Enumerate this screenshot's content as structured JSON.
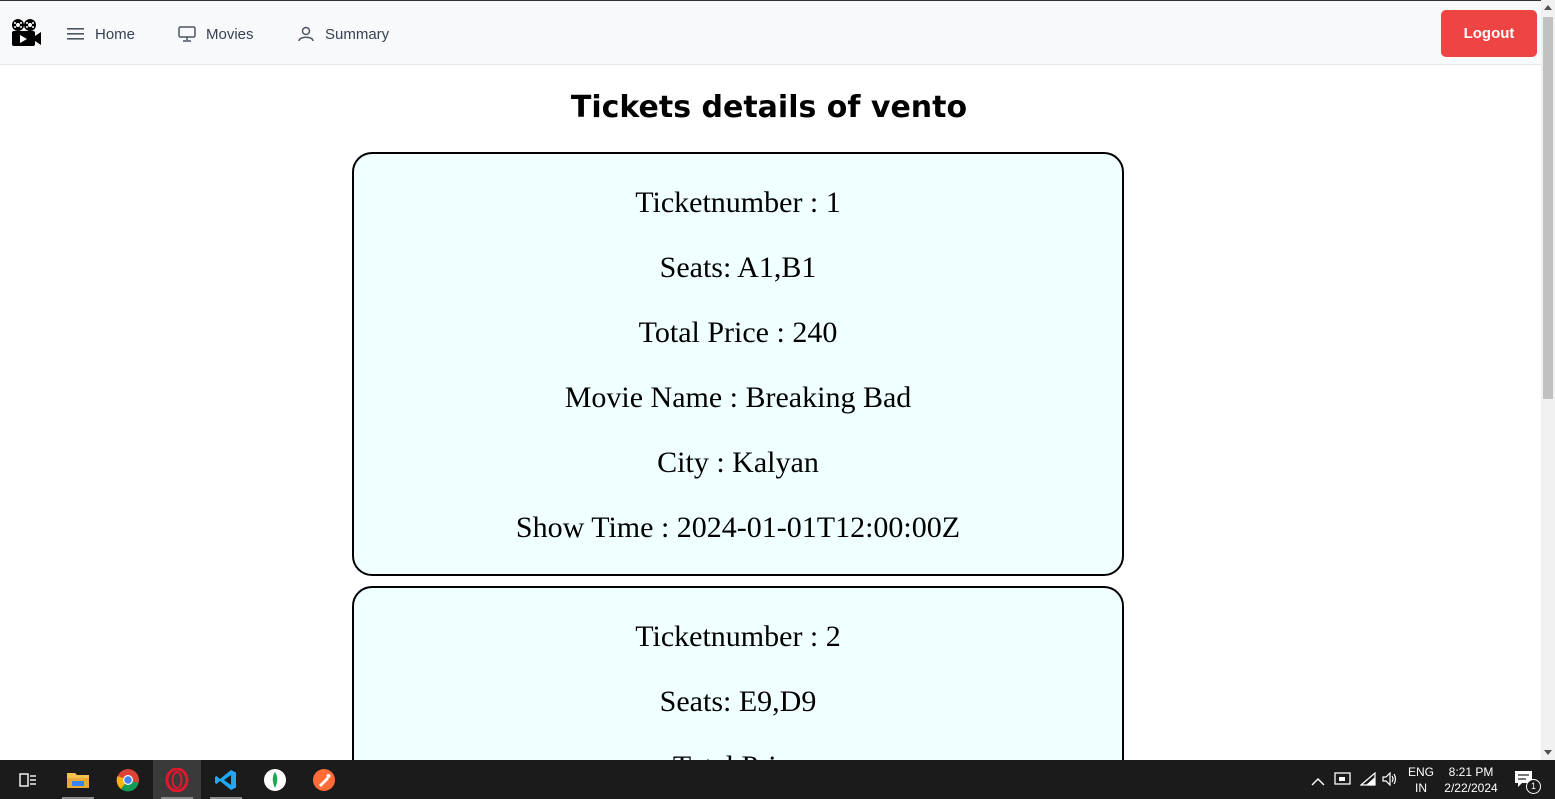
{
  "nav": {
    "home_label": "Home",
    "movies_label": "Movies",
    "summary_label": "Summary",
    "logout_label": "Logout"
  },
  "page": {
    "title": "Tickets details of vento"
  },
  "tickets": [
    {
      "ticketnumber": "Ticketnumber : 1",
      "seats": "Seats: A1,B1",
      "total_price": "Total Price : 240",
      "movie_name": "Movie Name : Breaking Bad",
      "city": "City : Kalyan",
      "show_time": "Show Time : 2024-01-01T12:00:00Z"
    },
    {
      "ticketnumber": "Ticketnumber : 2",
      "seats": "Seats: E9,D9",
      "total_price": "Total Price"
    }
  ],
  "taskbar": {
    "lang_top": "ENG",
    "lang_bottom": "IN",
    "time": "8:21 PM",
    "date": "2/22/2024",
    "notification_count": "1"
  },
  "colors": {
    "logout_bg": "#ef4444",
    "ticket_bg": "#f0ffff",
    "navbar_bg": "#f8f9fa"
  }
}
